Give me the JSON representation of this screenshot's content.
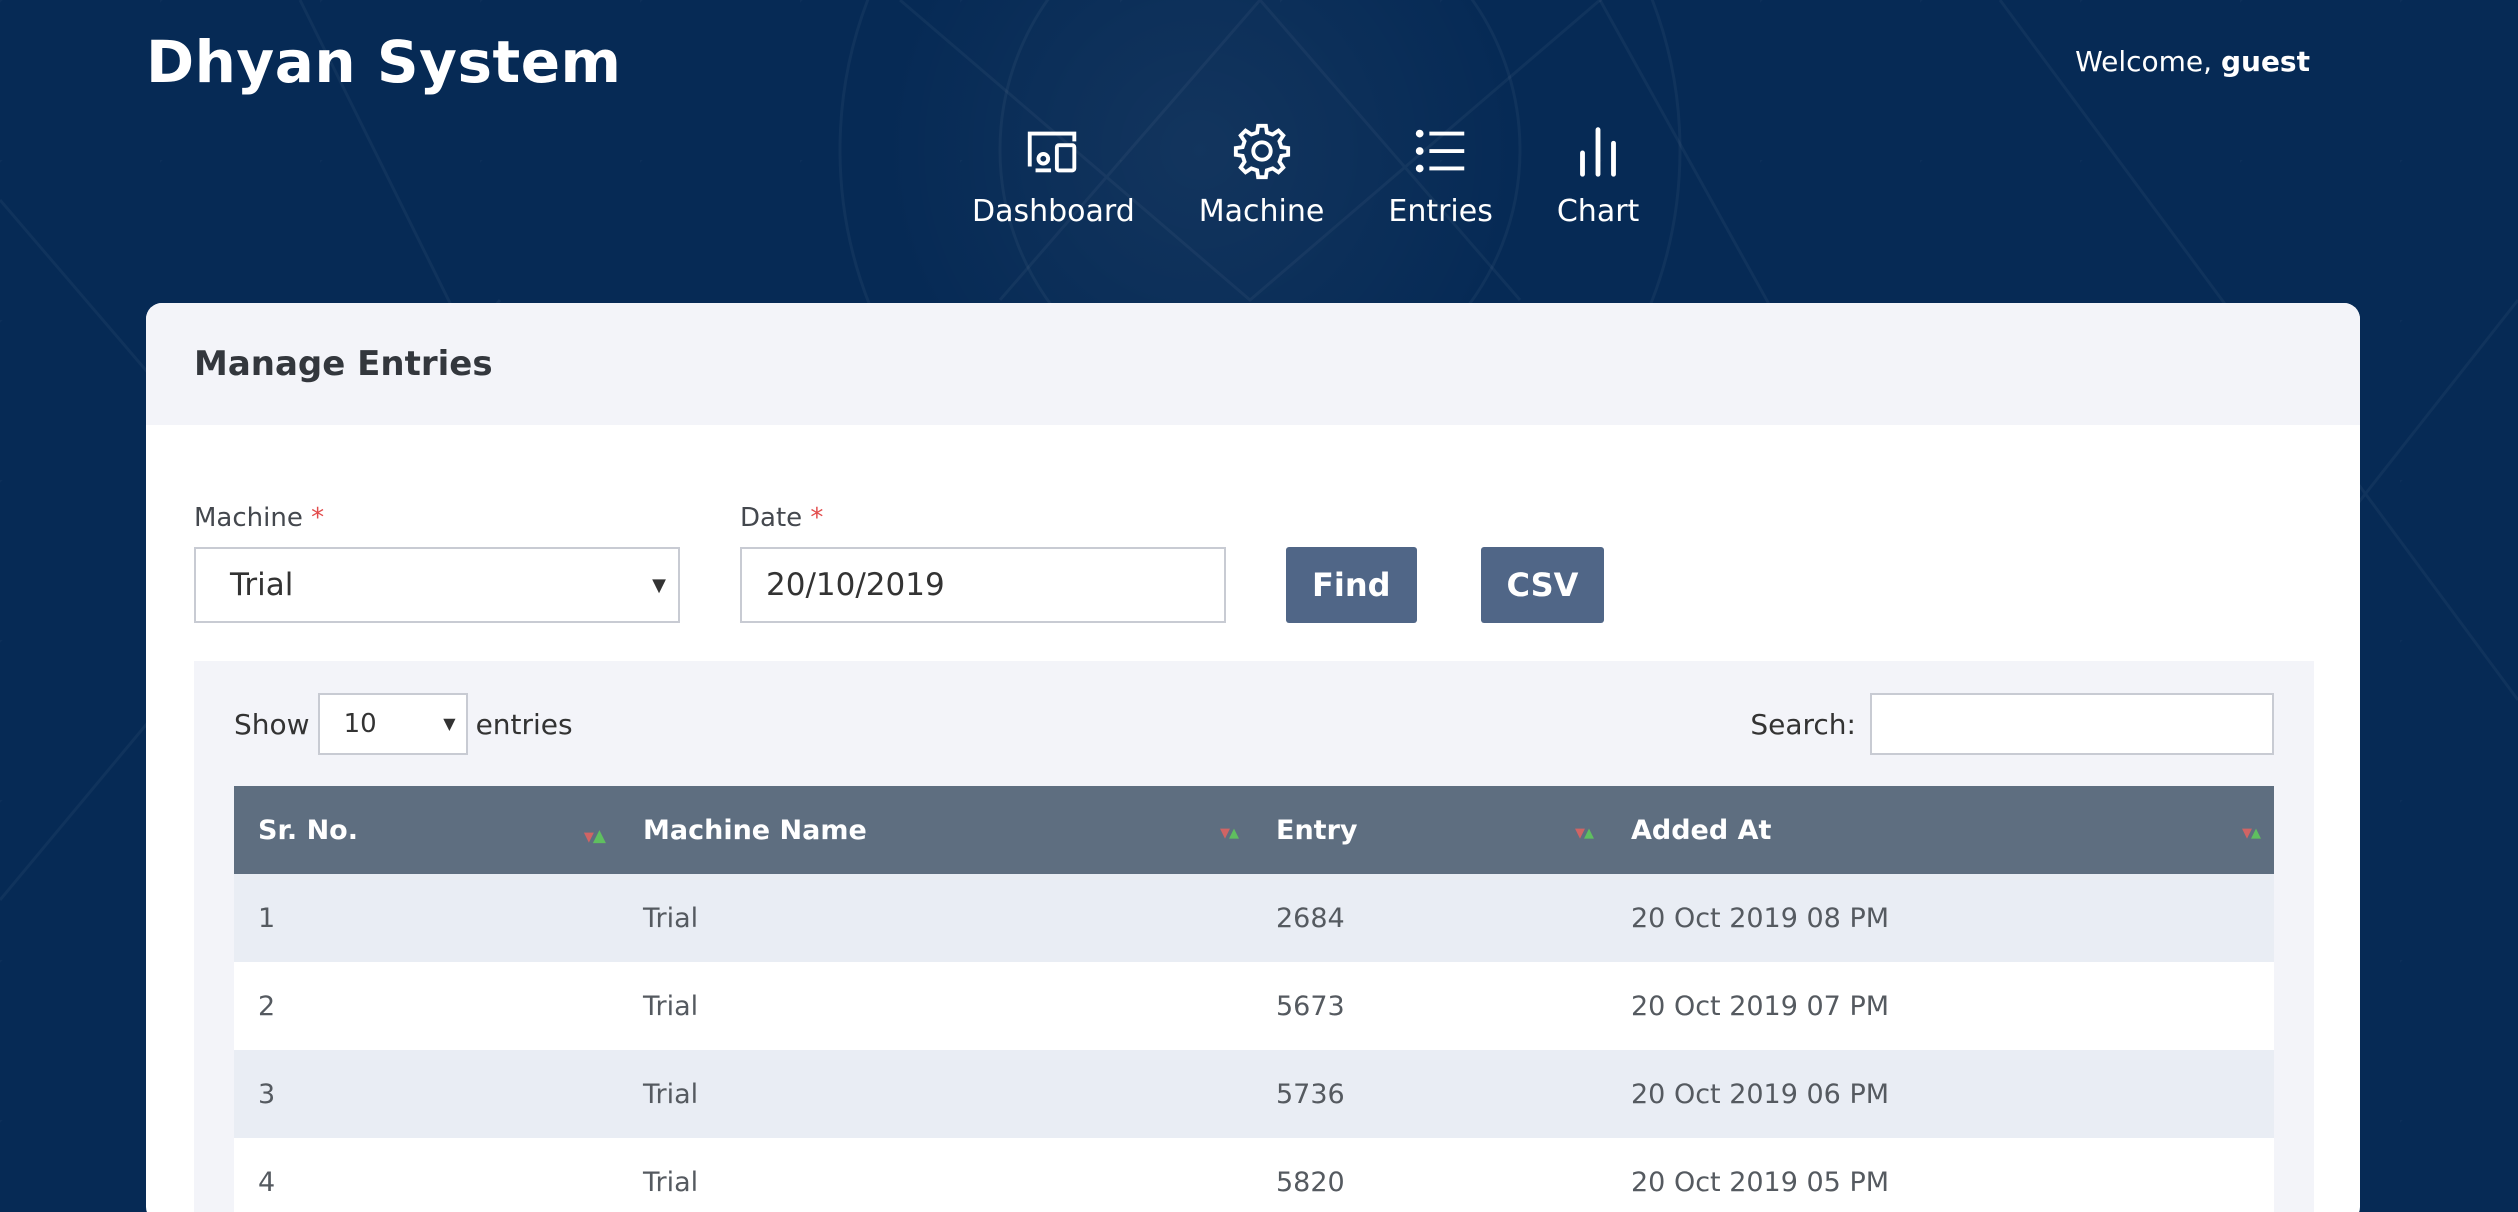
{
  "header": {
    "brand": "Dhyan System",
    "welcome_prefix": "Welcome,",
    "welcome_user": "guest"
  },
  "nav": {
    "items": [
      {
        "label": "Dashboard",
        "icon": "devices-icon"
      },
      {
        "label": "Machine",
        "icon": "gear-icon"
      },
      {
        "label": "Entries",
        "icon": "list-icon"
      },
      {
        "label": "Chart",
        "icon": "bar-chart-icon"
      }
    ]
  },
  "card": {
    "title": "Manage Entries"
  },
  "form": {
    "machine_label": "Machine",
    "machine_value": "Trial",
    "date_label": "Date",
    "date_value": "20/10/2019",
    "required_mark": "*",
    "find_label": "Find",
    "csv_label": "CSV"
  },
  "datatable": {
    "show_label": "Show",
    "entries_label": "entries",
    "length_value": "10",
    "search_label": "Search:",
    "columns": [
      "Sr. No.",
      "Machine Name",
      "Entry",
      "Added At"
    ],
    "rows": [
      [
        "1",
        "Trial",
        "2684",
        "20 Oct 2019 08 PM"
      ],
      [
        "2",
        "Trial",
        "5673",
        "20 Oct 2019 07 PM"
      ],
      [
        "3",
        "Trial",
        "5736",
        "20 Oct 2019 06 PM"
      ],
      [
        "4",
        "Trial",
        "5820",
        "20 Oct 2019 05 PM"
      ]
    ]
  },
  "colors": {
    "background": "#062a55",
    "button": "#506687",
    "table_header": "#5e6e80",
    "required": "#e24c4c"
  }
}
